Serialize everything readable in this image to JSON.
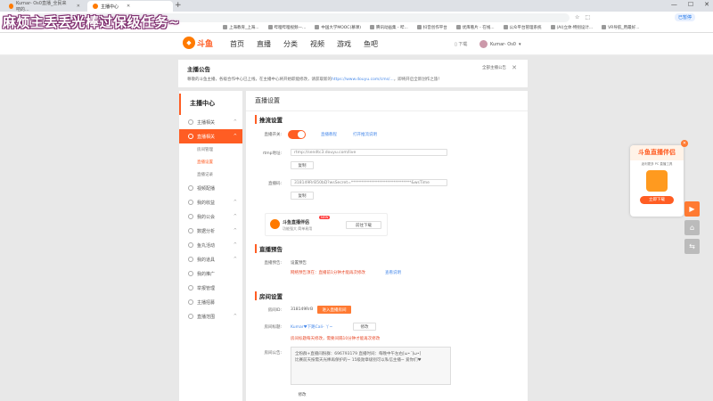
{
  "browser": {
    "tabs": [
      {
        "title": "Kumar- Os0直播_全民来吧的..."
      },
      {
        "title": "主播中心"
      }
    ],
    "url": "",
    "profile_label": "已暂停",
    "bookmarks": [
      "上海教育_上海...",
      "哔哩哔哩视频—...",
      "中国大学MOOC(慕课)",
      "腾讯动画集 - 哔...",
      "抖音创作平台",
      "优库看片 - 在线...",
      "公众平台管理系统",
      "(AI)立体·特别设计...",
      "VR导航_用最好..."
    ]
  },
  "overlay_title": "麻烦主丢丢光棒过保级任务~",
  "topnav": {
    "logo_text": "斗鱼",
    "items": [
      "首页",
      "直播",
      "分类",
      "视频",
      "游戏",
      "鱼吧"
    ],
    "download": "下载",
    "user_name": "Kumar- Os0"
  },
  "announcement": {
    "title": "主播公告",
    "text_before": "尊敬的斗鱼主播，各级合作中心已上线，在主播中心将开始职能修改，请获取新的",
    "link": "https://www.douyu.com/cms/...",
    "text_after": "，即将开启全新创作之旅！",
    "all_label": "全部主播公告"
  },
  "sidebar": {
    "title": "主播中心",
    "items": [
      {
        "label": "主播相关",
        "arrow": "^"
      },
      {
        "label": "直播相关",
        "arrow": "^"
      },
      {
        "label": "视频配播",
        "arrow": ""
      },
      {
        "label": "我的收益",
        "arrow": "^"
      },
      {
        "label": "我的公会",
        "arrow": "^"
      },
      {
        "label": "数据分析",
        "arrow": "^"
      },
      {
        "label": "鱼丸活动",
        "arrow": "^"
      },
      {
        "label": "我的道具",
        "arrow": "^"
      },
      {
        "label": "我的推广",
        "arrow": ""
      },
      {
        "label": "举报管理",
        "arrow": ""
      },
      {
        "label": "主播招募",
        "arrow": ""
      },
      {
        "label": "直播范围",
        "arrow": "^"
      }
    ],
    "subitems": [
      "房间管理",
      "直播设置",
      "直播记录"
    ]
  },
  "main": {
    "title": "直播设置",
    "push": {
      "section": "推流设置",
      "switch_label": "直播开关:",
      "link_tutorial": "直播教程",
      "link_test": "打开推流说明",
      "rtmp_label": "rtmp地址:",
      "rtmp_value": "rtmp://sendtc3.douyu.com/live",
      "copy1": "复制",
      "code_label": "直播码:",
      "code_value": "318149RrB50bD?wsSecret=******************************&wsTime",
      "copy2": "复制"
    },
    "promo": {
      "title": "斗鱼直播伴侣",
      "badge": "NEW",
      "desc": "功能强大 简单易用",
      "button": "前往下载"
    },
    "forecast": {
      "section": "直播预告",
      "label": "直播预告:",
      "button": "设置预告",
      "note": "网络预告须在：直播前1分钟才能再次修改",
      "link": "查看说明"
    },
    "room": {
      "section": "房间设置",
      "id_label": "房间ID:",
      "id_value": "318149RrB",
      "id_button": "进入直播房间",
      "title_label": "房间标题:",
      "title_value": "Kumar♥下路Cali- 丫~",
      "edit1": "修改",
      "title_note": "房间标题每天修改，需要间隔10分钟才能再次修改",
      "notice_label": "房间公告:",
      "notice_line1": "全粉群+直播间粉群：696793179 直播时间：每晚中午左右[ω•´]ω•]",
      "notice_line2": "比赛前天按需天光棒再保护的~ 15级勋章级别可以私信主播~ 爱你们♥",
      "edit2": "修改"
    }
  },
  "float_card": {
    "title": "斗鱼直播伴侣",
    "sub": "返利更多 PC 直播工具",
    "button": "立即下载"
  }
}
